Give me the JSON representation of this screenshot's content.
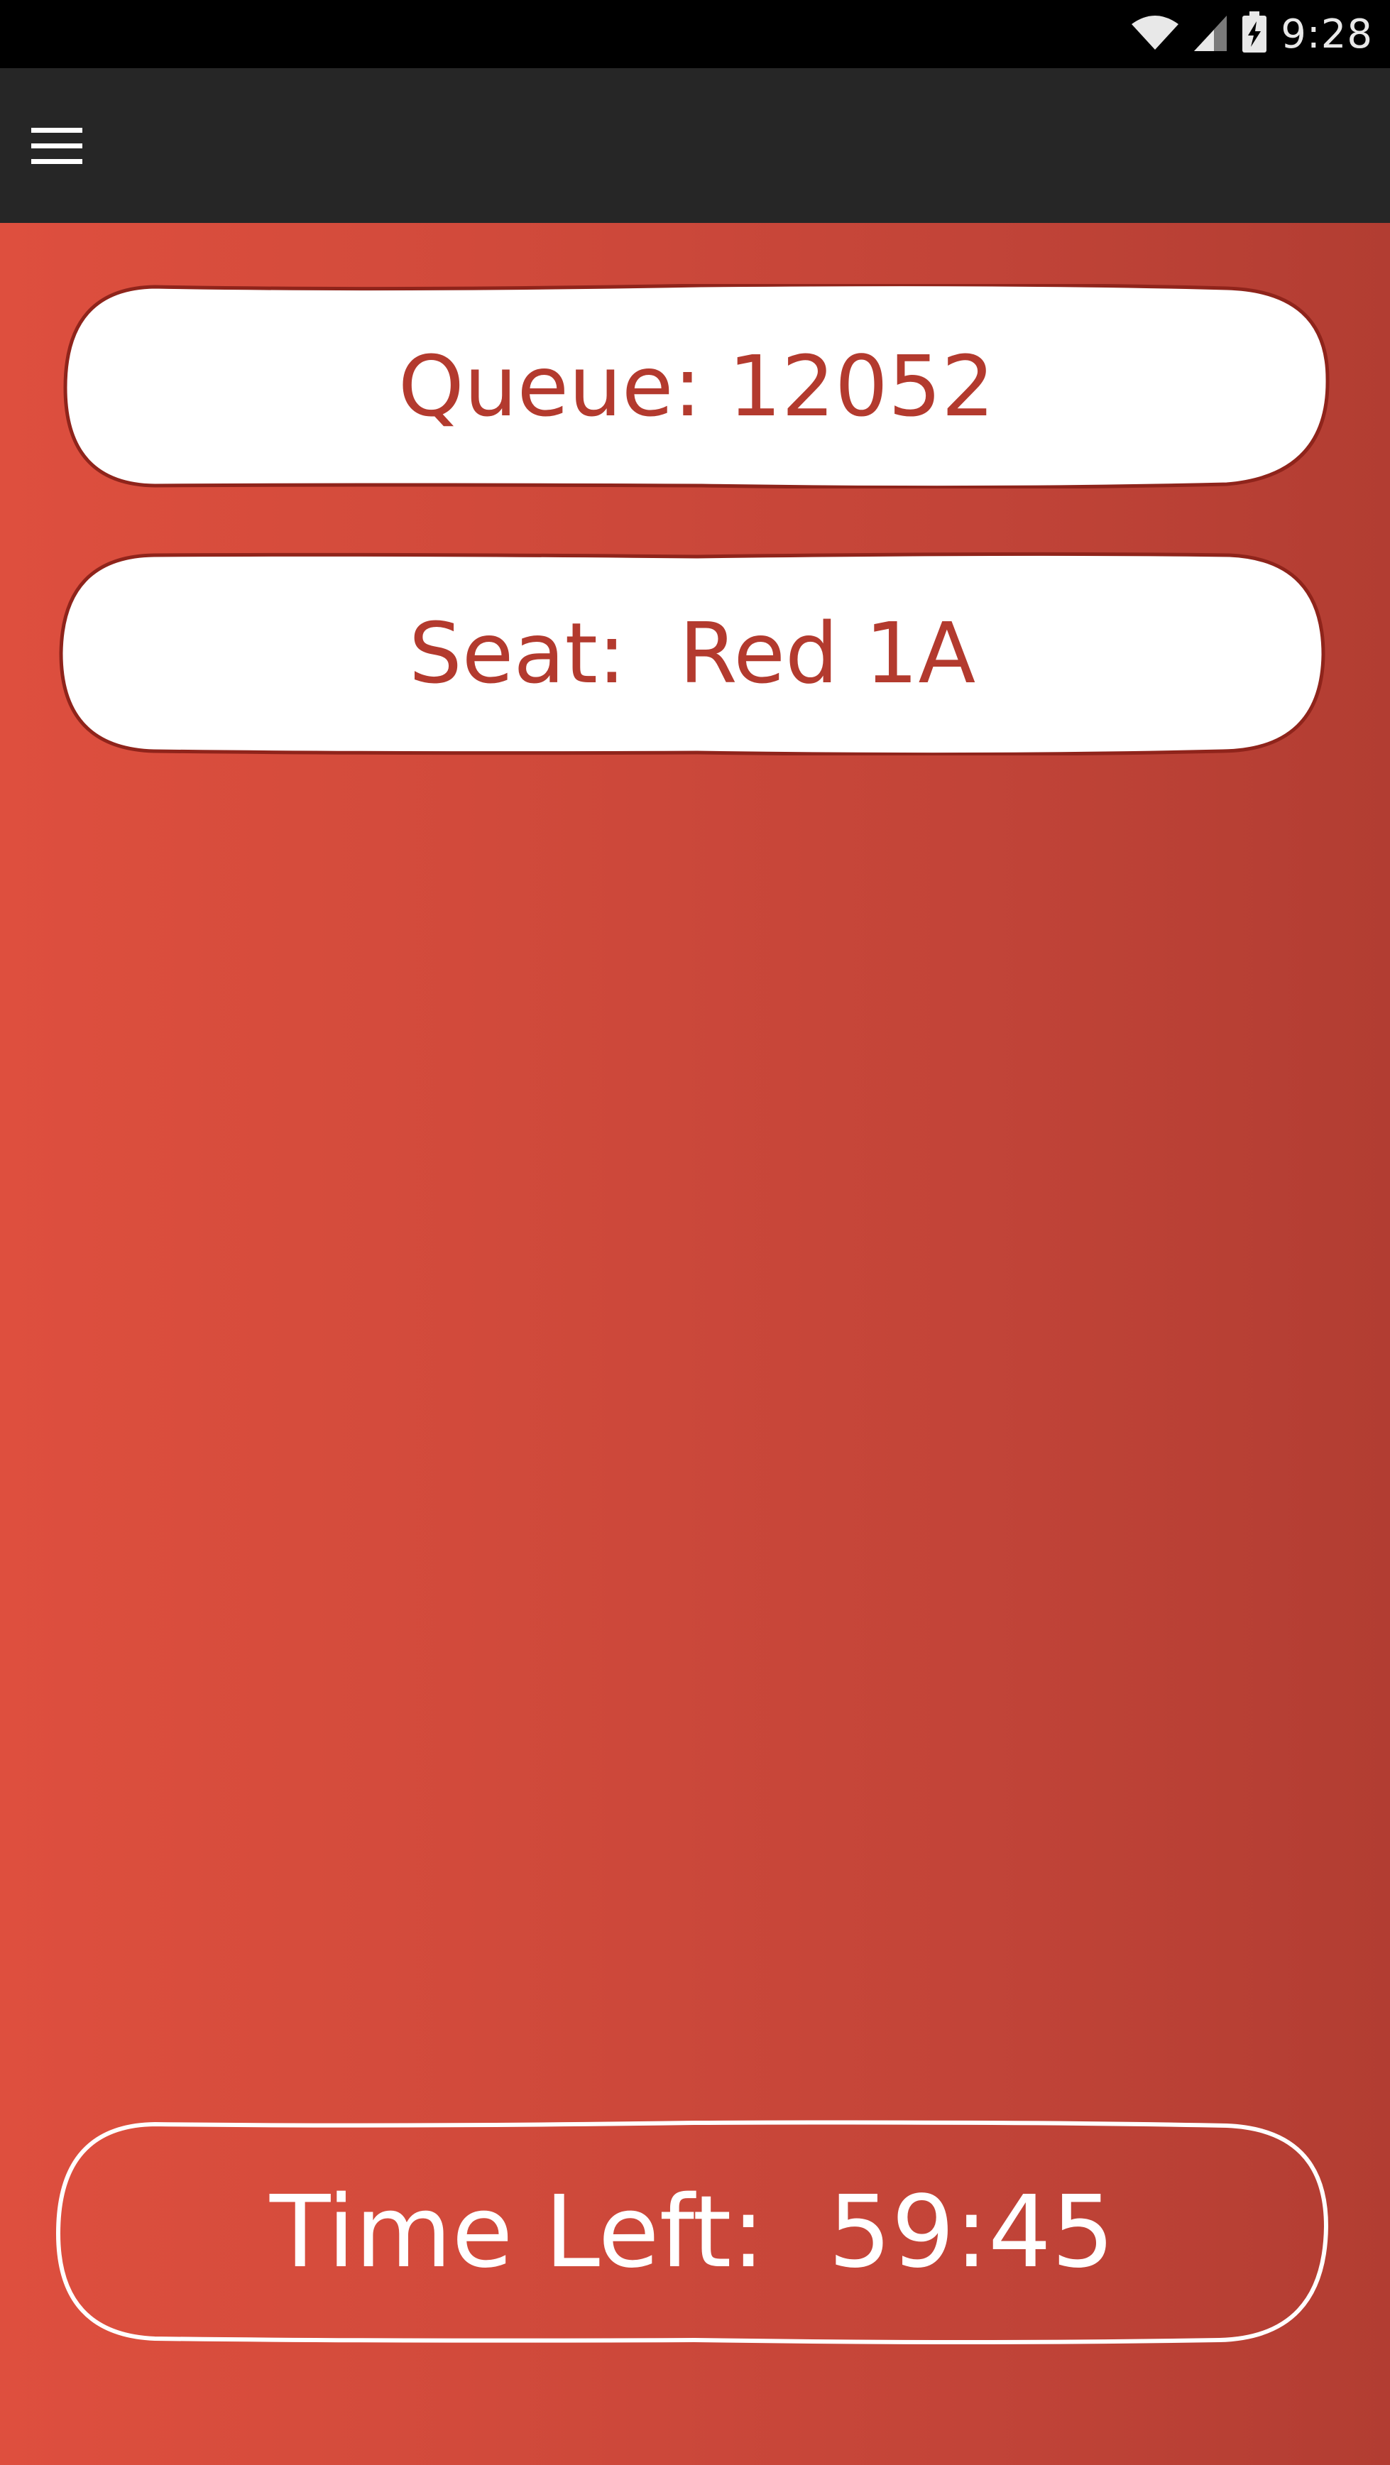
{
  "status_bar": {
    "time": "9:28",
    "icons": [
      "wifi-icon",
      "signal-icon",
      "battery-charging-icon"
    ]
  },
  "app_bar": {
    "menu_icon": "hamburger-menu-icon"
  },
  "main": {
    "queue_label": "Queue: 12052",
    "seat_label": "Seat:  Red 1A",
    "time_left_label": "Time Left:  59:45"
  },
  "colors": {
    "status_bar_bg": "#000000",
    "app_bar_bg": "#262626",
    "gradient_left": "#de4f3e",
    "gradient_right": "#b23d32",
    "pill_fill": "#ffffff",
    "pill_stroke": "#8f241b",
    "pill_text": "#b33a2e"
  }
}
